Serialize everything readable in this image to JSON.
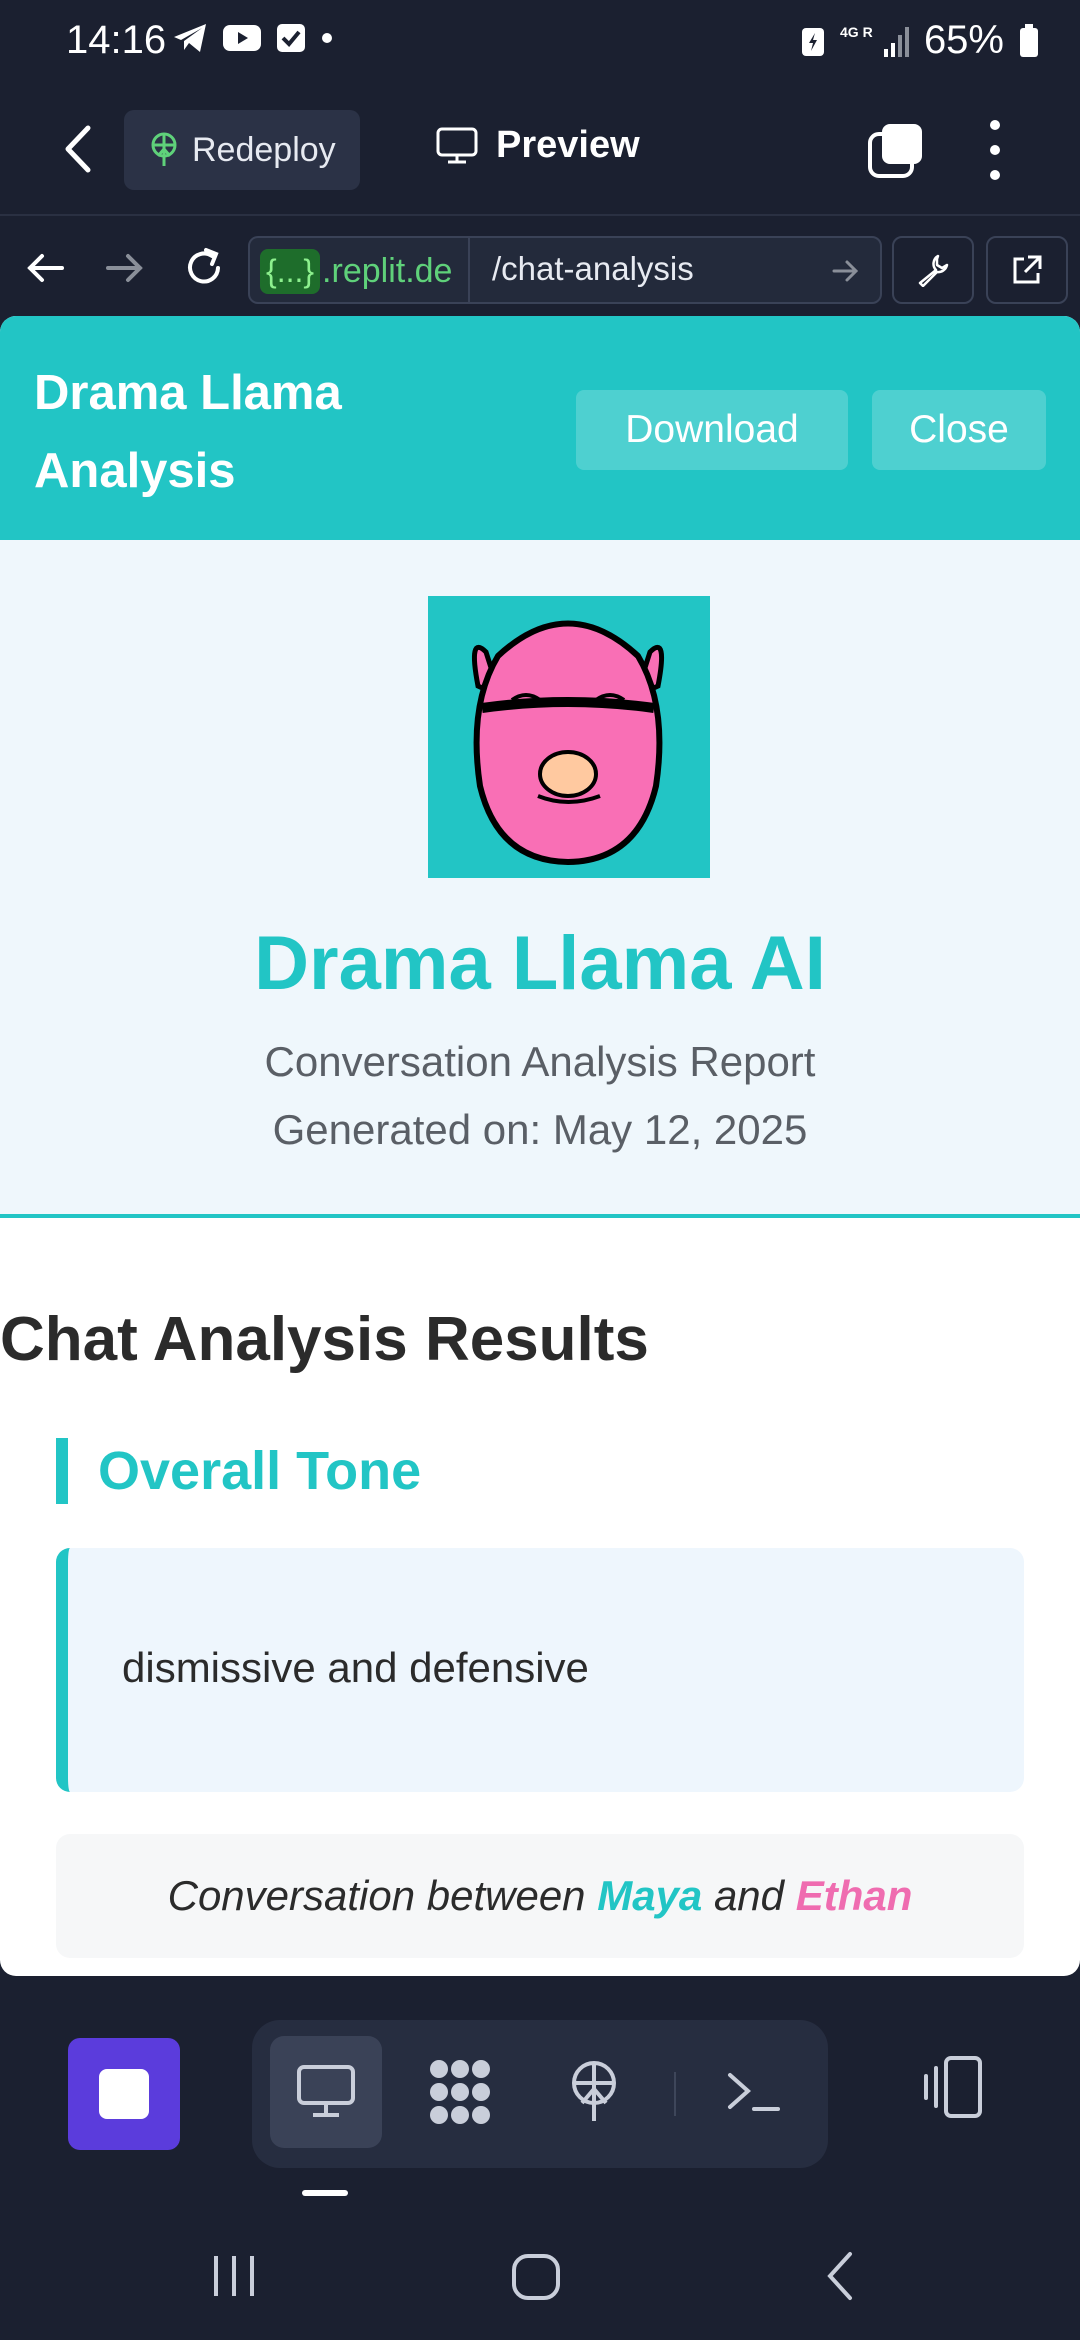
{
  "status_bar": {
    "time": "14:16",
    "right_labels": "4G R",
    "battery": "65%"
  },
  "top_bar": {
    "redeploy_label": "Redeploy",
    "preview_label": "Preview"
  },
  "browser": {
    "url_badge": "{...}",
    "url_domain": ".replit.de",
    "url_path": "/chat-analysis"
  },
  "app": {
    "title": "Drama Llama Analysis",
    "download_label": "Download",
    "close_label": "Close",
    "report_title": "Drama Llama AI",
    "report_subtitle": "Conversation Analysis Report",
    "report_date": "Generated on: May 12, 2025",
    "results_title": "Chat Analysis Results",
    "tone_heading": "Overall Tone",
    "tone_value": "dismissive and defensive",
    "conversation_prefix": "Conversation between",
    "conversation_and": "and",
    "participant_a": "Maya",
    "participant_b": "Ethan"
  },
  "colors": {
    "accent": "#22c5c5",
    "secondary": "#ef6cb0",
    "dock_stop": "#5b3cdc",
    "background": "#1b2030"
  },
  "icons": {
    "top_bar": [
      "back-chevron-icon",
      "redeploy-icon",
      "monitor-icon",
      "tabs-icon",
      "more-vert-icon"
    ],
    "browser": [
      "back-arrow-icon",
      "forward-arrow-icon",
      "reload-icon",
      "go-arrow-icon",
      "wrench-icon",
      "open-external-icon"
    ],
    "dock": [
      "stop-icon",
      "monitor-icon",
      "apps-grid-icon",
      "deploy-icon",
      "terminal-icon",
      "device-icon"
    ],
    "android_nav": [
      "recents-icon",
      "home-icon",
      "back-icon"
    ]
  }
}
